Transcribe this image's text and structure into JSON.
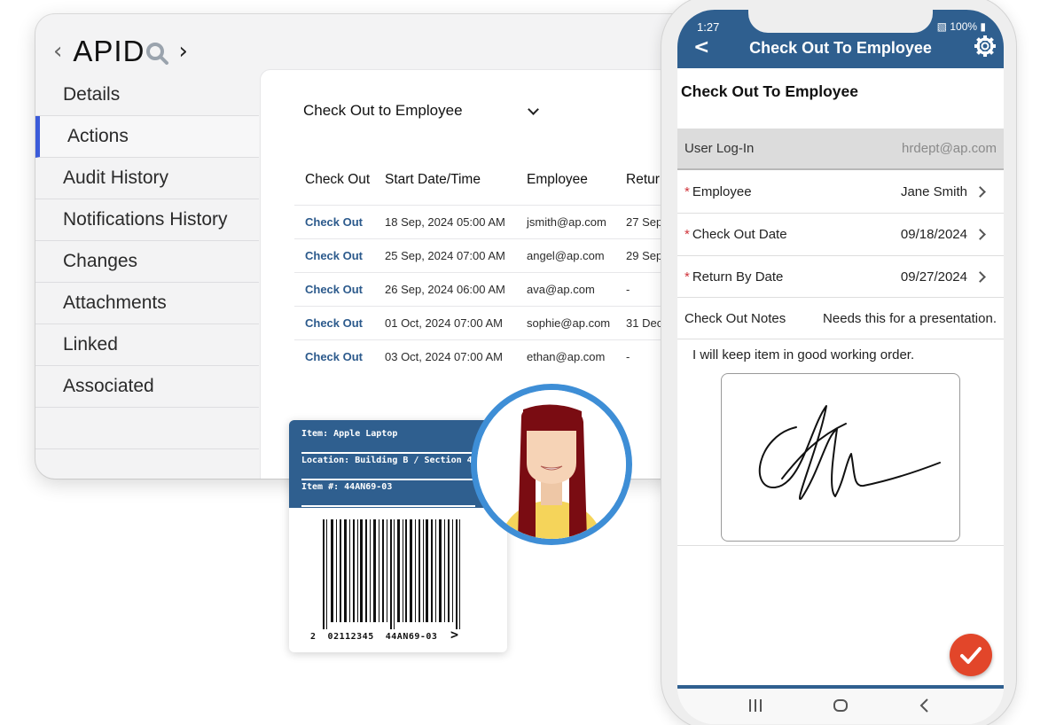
{
  "desktop": {
    "brand": {
      "logo_text": "APID"
    },
    "sidebar": {
      "items": [
        {
          "label": "Details"
        },
        {
          "label": "Actions"
        },
        {
          "label": "Audit History"
        },
        {
          "label": "Notifications History"
        },
        {
          "label": "Changes"
        },
        {
          "label": "Attachments"
        },
        {
          "label": "Linked"
        },
        {
          "label": "Associated"
        }
      ]
    },
    "action_select": {
      "value": "Check Out to Employee"
    },
    "table": {
      "columns": [
        "Check Out",
        "Start Date/Time",
        "Employee",
        "Retur"
      ],
      "rows": [
        {
          "action": "Check Out",
          "start": "18 Sep, 2024 05:00 AM",
          "employee": "jsmith@ap.com",
          "return": "27 Sep"
        },
        {
          "action": "Check Out",
          "start": "25 Sep, 2024 07:00 AM",
          "employee": "angel@ap.com",
          "return": "29 Sep"
        },
        {
          "action": "Check Out",
          "start": "26 Sep, 2024 06:00 AM",
          "employee": "ava@ap.com",
          "return": "-"
        },
        {
          "action": "Check Out",
          "start": "01 Oct, 2024 07:00 AM",
          "employee": "sophie@ap.com",
          "return": "31 Dec"
        },
        {
          "action": "Check Out",
          "start": "03 Oct, 2024 07:00 AM",
          "employee": "ethan@ap.com",
          "return": "-"
        }
      ]
    }
  },
  "asset_label": {
    "item": "Item: Apple Laptop",
    "location": "Location: Building B / Section 4",
    "item_number": "Item #: 44AN69-03",
    "barcode_text": "2  02112345  44AN69-03",
    "barcode_arrow": ">"
  },
  "phone": {
    "status": {
      "time": "1:27",
      "battery": "100%"
    },
    "header_title": "Check Out To Employee",
    "form_title": "Check Out To Employee",
    "fields": {
      "login": {
        "label": "User Log-In",
        "value": "hrdept@ap.com"
      },
      "employee": {
        "label": "Employee",
        "value": "Jane Smith"
      },
      "checkout_date": {
        "label": "Check Out Date",
        "value": "09/18/2024"
      },
      "return_date": {
        "label": "Return By Date",
        "value": "09/27/2024"
      },
      "notes": {
        "label": "Check Out Notes",
        "value": "Needs this for a presentation."
      }
    },
    "required_marker": "*",
    "agreement": "I will keep item in good working order."
  },
  "colors": {
    "brand_blue": "#2f5f8f",
    "active_accent": "#3b5bd9",
    "link": "#2c5a8c",
    "fab": "#e2462a",
    "avatar_ring": "#3e8ed6",
    "required": "#d0343b"
  },
  "icons": [
    "chevron-left-icon",
    "search-icon",
    "chevron-right-icon",
    "chevron-down-icon",
    "back-icon",
    "gear-icon",
    "checkmark-icon",
    "signal-icon",
    "battery-icon",
    "recents-icon",
    "home-icon",
    "back-nav-icon"
  ]
}
